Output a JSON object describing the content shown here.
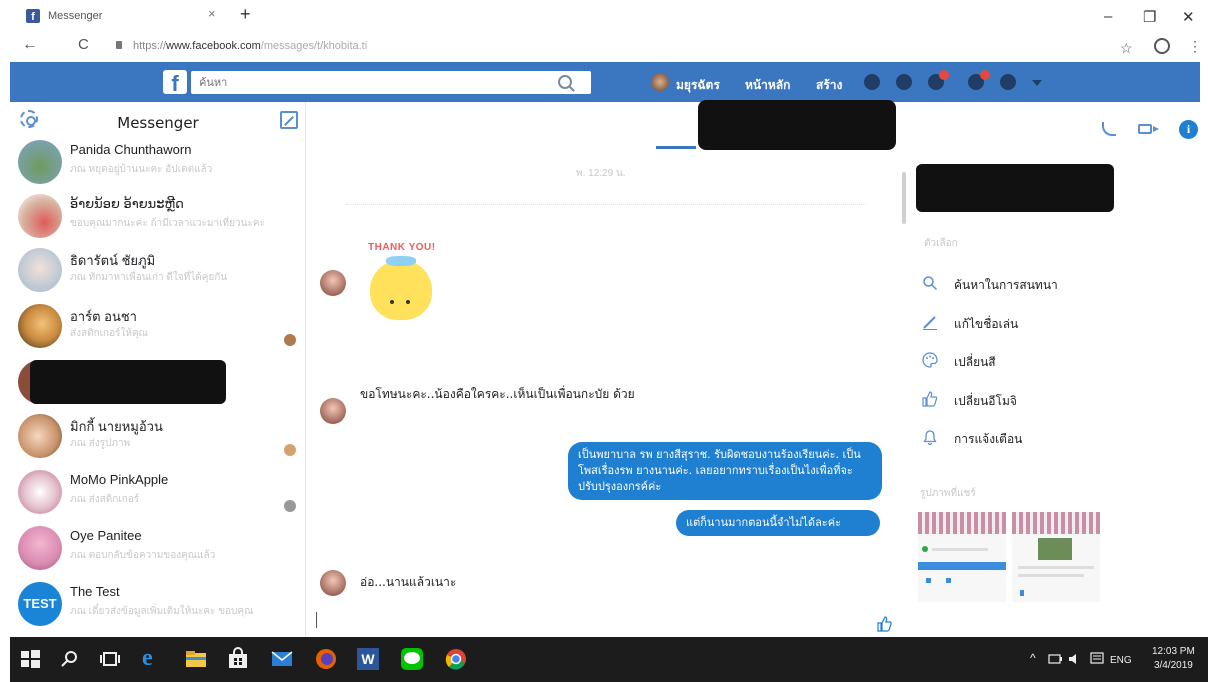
{
  "browser": {
    "tab_title": "Messenger",
    "tab_close": "×",
    "new_tab": "+",
    "url_scheme": "https://",
    "url_host": "www.facebook.com",
    "url_path": "/messages/t/khobita.ti",
    "back": "←",
    "reload": "C",
    "star": "☆",
    "kebab": "⋮",
    "min": "–",
    "restore": "❐",
    "close": "✕"
  },
  "fb": {
    "logo": "f",
    "search_placeholder": "ค้นหา",
    "user_name": "มยุรฉัตร",
    "home": "หน้าหลัก",
    "create": "สร้าง",
    "brand_color": "#3b77c0"
  },
  "left": {
    "title": "Messenger",
    "conversations": [
      {
        "name": "Panida Chunthaworn",
        "snippet": "ภณ  หยุดอยู่บ้านนะคะ อัปเดตแล้ว",
        "time": "",
        "avatar": "#7fa3c9"
      },
      {
        "name": "ອ້າຍນ້ອຍ ອ້າຍນະຫຼີດ",
        "snippet": "ขอบคุณมากนะคะ ถ้ามีเวลาแวะมาเที่ยวนะคะ",
        "time": "",
        "avatar": "#d7b3a0"
      },
      {
        "name": "ธิดารัตน์ ชัยภูมิ",
        "snippet": "ภณ  ทักมาหาเพื่อนเก่า ดีใจที่ได้คุยกัน",
        "time": "",
        "avatar": "#9fb7d2"
      },
      {
        "name": "อาร์ต อนชา",
        "snippet": "ส่งสติกเกอร์ให้คุณ",
        "time": "",
        "avatar": "#c98a3d"
      },
      {
        "name": "",
        "snippet": "",
        "time": "",
        "avatar": "#8b4c3a"
      },
      {
        "name": "มิกกี้ นายหมูอ้วน",
        "snippet": "ภณ  ส่งรูปภาพ",
        "time": "",
        "avatar": "#c9926a"
      },
      {
        "name": "MoMo PinkApple",
        "snippet": "ภณ  ส่งสติกเกอร์",
        "time": "",
        "avatar": "#e4c3cf"
      },
      {
        "name": "Oye Panitee",
        "snippet": "ภณ  ตอบกลับข้อความของคุณแล้ว",
        "time": "",
        "avatar": "#d98ab0"
      },
      {
        "name": "The Test",
        "snippet": "ภณ  เดี๋ยวส่งข้อมูลเพิ่มเติมให้นะคะ ขอบคุณ",
        "time": "",
        "avatar": "#1a84d6",
        "avatar_text": "TEST"
      }
    ]
  },
  "chat": {
    "date_separator": "พ. 12:29 น.",
    "sticker_text": "THANK YOU!",
    "incoming_1": "ขอโทษนะคะ..น้องคือใครคะ..เห็นเป็นเพื่อนกะบัย ด้วย",
    "outgoing_1": "เป็นพยาบาล รพ ยางสีสุราช. รับผิดชอบงานร้องเรียนค่ะ. เป็นโพสเรื่องรพ ยางนานค่ะ. เลยอยากทราบเรื่องเป็นไงเพื่อที่จะปรับปรุงองกรค์ค่ะ",
    "outgoing_2": "แต่ก็นานมากตอนนี้จำไม่ได้ละค่ะ",
    "incoming_2": "อ่อ...นานแล้วเนาะ",
    "bubble_color": "#1f7fd0"
  },
  "right": {
    "options_header": "ตัวเลือก",
    "options": [
      {
        "label": "ค้นหาในการสนทนา",
        "icon": "search-icon"
      },
      {
        "label": "แก้ไขชื่อเล่น",
        "icon": "pencil-icon"
      },
      {
        "label": "เปลี่ยนสี",
        "icon": "palette-icon"
      },
      {
        "label": "เปลี่ยนอีโมจิ",
        "icon": "thumbs-up-icon"
      },
      {
        "label": "การแจ้งเตือน",
        "icon": "bell-icon"
      }
    ],
    "photos_header": "รูปภาพที่แชร์"
  },
  "taskbar": {
    "lang": "ENG",
    "time": "12:03 PM",
    "date": "3/4/2019"
  }
}
